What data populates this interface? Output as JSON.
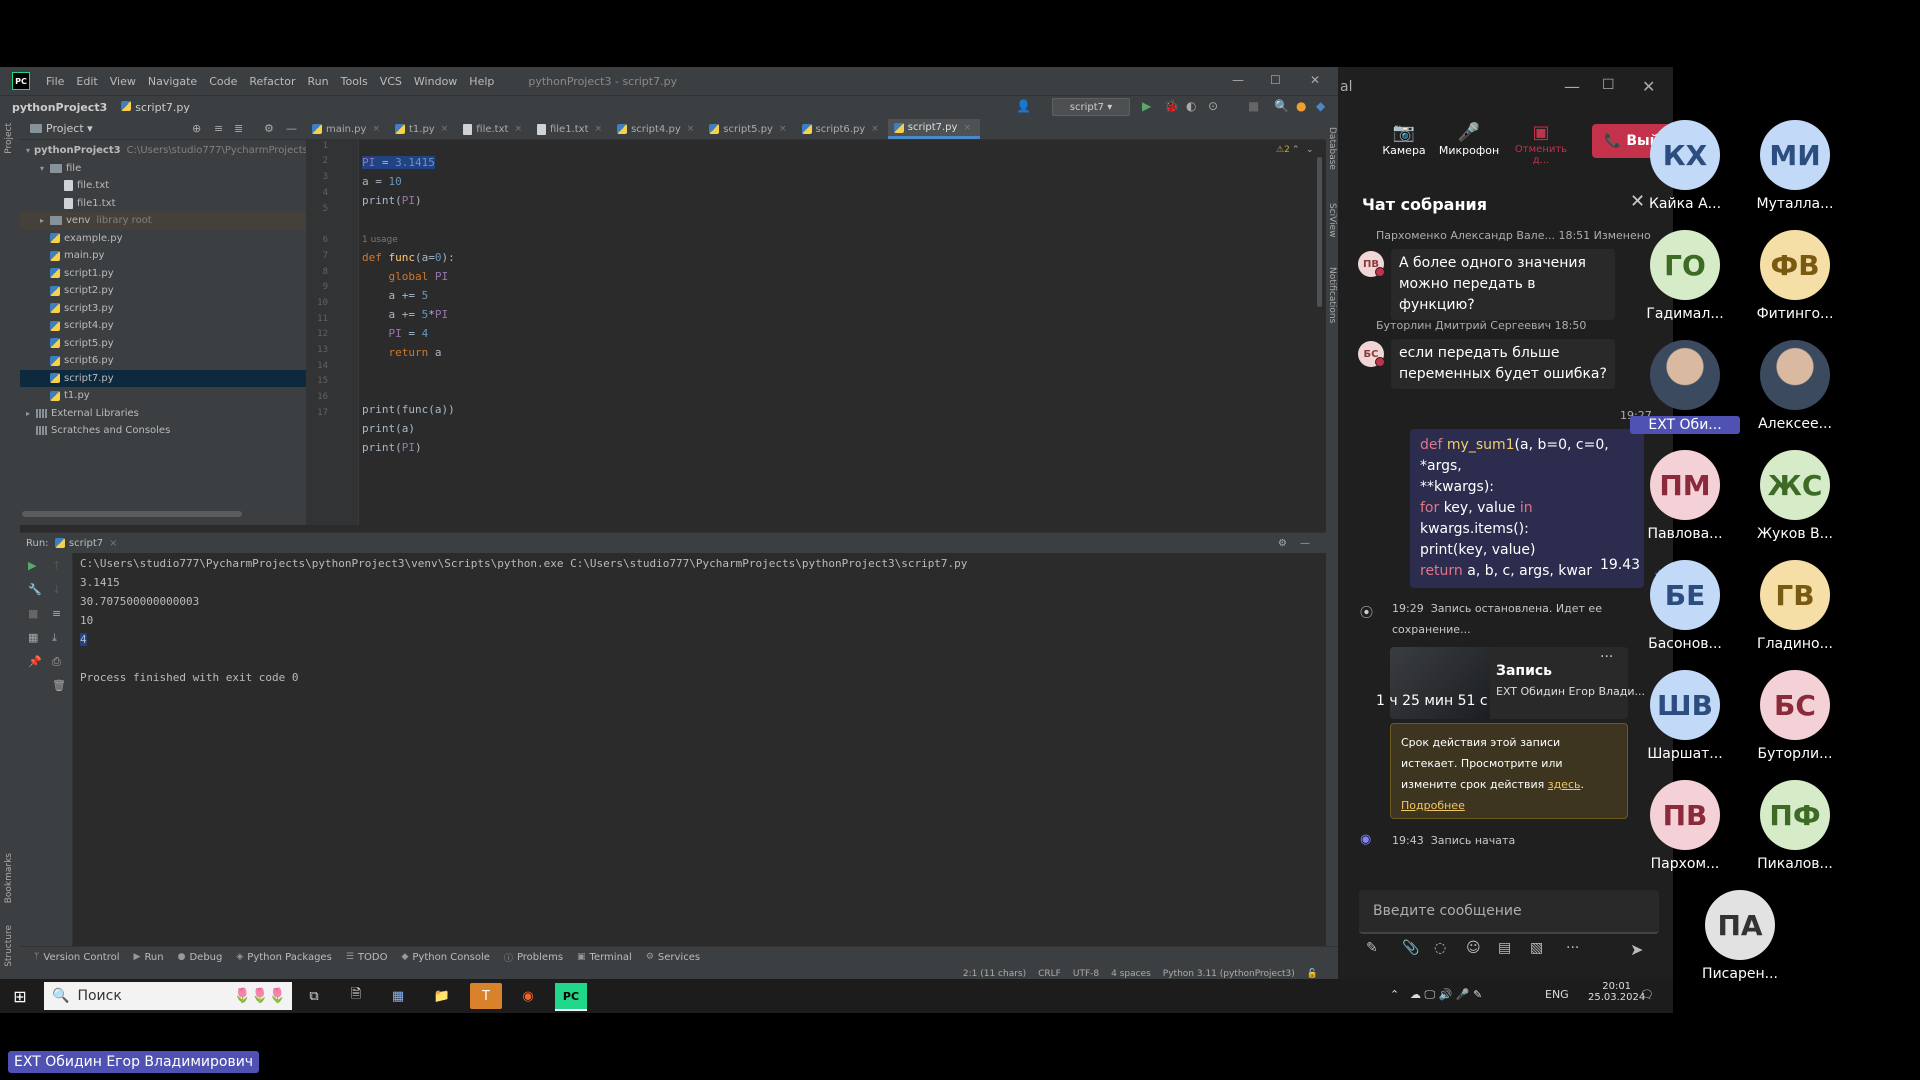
{
  "ide": {
    "logo": "PC",
    "menu": [
      "File",
      "Edit",
      "View",
      "Navigate",
      "Code",
      "Refactor",
      "Run",
      "Tools",
      "VCS",
      "Window",
      "Help"
    ],
    "window_title": "pythonProject3 - script7.py",
    "breadcrumb": [
      "pythonProject3",
      "script7.py"
    ],
    "run_config": "script7",
    "project_label": "Project",
    "tree": [
      {
        "label": "pythonProject3",
        "extra": "C:\\Users\\studio777\\PycharmProjects\\pythonProject3",
        "kind": "folder",
        "indent": 0,
        "open": true
      },
      {
        "label": "file",
        "kind": "folder",
        "indent": 1,
        "open": true
      },
      {
        "label": "file.txt",
        "kind": "txt",
        "indent": 2
      },
      {
        "label": "file1.txt",
        "kind": "txt",
        "indent": 2
      },
      {
        "label": "venv",
        "extra": "library root",
        "kind": "folder",
        "indent": 1,
        "open": false,
        "venv": true
      },
      {
        "label": "example.py",
        "kind": "py",
        "indent": 1
      },
      {
        "label": "main.py",
        "kind": "py",
        "indent": 1
      },
      {
        "label": "script1.py",
        "kind": "py",
        "indent": 1
      },
      {
        "label": "script2.py",
        "kind": "py",
        "indent": 1
      },
      {
        "label": "script3.py",
        "kind": "py",
        "indent": 1
      },
      {
        "label": "script4.py",
        "kind": "py",
        "indent": 1
      },
      {
        "label": "script5.py",
        "kind": "py",
        "indent": 1
      },
      {
        "label": "script6.py",
        "kind": "py",
        "indent": 1
      },
      {
        "label": "script7.py",
        "kind": "py",
        "indent": 1,
        "selected": true
      },
      {
        "label": "t1.py",
        "kind": "py",
        "indent": 1
      },
      {
        "label": "External Libraries",
        "kind": "lib",
        "indent": 0,
        "open": false
      },
      {
        "label": "Scratches and Consoles",
        "kind": "lib",
        "indent": 0
      }
    ],
    "tabs": [
      {
        "label": "main.py",
        "active": false
      },
      {
        "label": "t1.py",
        "active": false
      },
      {
        "label": "file.txt",
        "active": false
      },
      {
        "label": "file1.txt",
        "active": false
      },
      {
        "label": "script4.py",
        "active": false
      },
      {
        "label": "script5.py",
        "active": false
      },
      {
        "label": "script6.py",
        "active": false
      },
      {
        "label": "script7.py",
        "active": true
      }
    ],
    "warnings": "⚠2",
    "line_numbers": [
      "1",
      "2",
      "3",
      "4",
      "5",
      "",
      "6",
      "7",
      "8",
      "9",
      "10",
      "11",
      "12",
      "13",
      "14",
      "15",
      "16",
      "17"
    ],
    "usage_hint": "1 usage",
    "run_tab": "Run:",
    "run_name": "script7",
    "output": [
      "C:\\Users\\studio777\\PycharmProjects\\pythonProject3\\venv\\Scripts\\python.exe C:\\Users\\studio777\\PycharmProjects\\pythonProject3\\script7.py",
      "3.1415",
      "30.707500000000003",
      "10",
      "4",
      "",
      "Process finished with exit code 0"
    ],
    "toolwindows": [
      "Version Control",
      "Run",
      "Debug",
      "Python Packages",
      "TODO",
      "Python Console",
      "Problems",
      "Terminal",
      "Services"
    ],
    "status": [
      "2:1 (11 chars)",
      "CRLF",
      "UTF-8",
      "4 spaces",
      "Python 3.11 (pythonProject3)"
    ],
    "left_strip": [
      "Project",
      "Bookmarks",
      "Structure"
    ],
    "right_strip": [
      "Database",
      "SciView",
      "Notifications"
    ]
  },
  "taskbar": {
    "search_placeholder": "Поиск",
    "lang": "ENG",
    "time": "20:01",
    "date": "25.03.2024"
  },
  "teams": {
    "app_title_fragment": "al",
    "controls": {
      "camera": "Камера",
      "mic": "Микрофон",
      "share": "Отменить д...",
      "leave": "Выйти"
    },
    "chat_title": "Чат собрания",
    "messages": [
      {
        "meta": "Пархоменко Александр Вале...  18:51  Изменено",
        "initials": "ПВ",
        "text": [
          "А более одного значения",
          "можно передать в функцию?"
        ]
      },
      {
        "meta": "Буторлин Дмитрий Сергеевич  18:50",
        "initials": "БС",
        "text": [
          "если передать бльше",
          "переменных будет ошибка?"
        ]
      }
    ],
    "own_time": "19:27",
    "own_small": "19.43",
    "system": [
      {
        "time": "19:29",
        "text": "Запись остановлена. Идет ее",
        "text2": "сохранение..."
      },
      {
        "time": "19:43",
        "text": "Запись начата"
      }
    ],
    "recording": {
      "title": "Запись",
      "owner": "EXT Обидин Егор Влади...",
      "duration": "1 ч 25 мин 51 с"
    },
    "warning": {
      "line1": "Срок действия этой записи",
      "line2": "истекает. Просмотрите или",
      "line3": "измените срок действия",
      "link": "здесь",
      "more": "Подробнее"
    },
    "compose_placeholder": "Введите сообщение"
  },
  "participants": [
    {
      "initials": "КХ",
      "name": "Кайка А...",
      "bg": "#c2d9f7",
      "fg": "#2b4d80"
    },
    {
      "initials": "МИ",
      "name": "Муталла...",
      "bg": "#c2d9f7",
      "fg": "#2b4d80"
    },
    {
      "initials": "ГО",
      "name": "Гадимал...",
      "bg": "#d6ebc8",
      "fg": "#3d6b26"
    },
    {
      "initials": "ФВ",
      "name": "Фитинго...",
      "bg": "#f5dfa6",
      "fg": "#7a5a11"
    },
    {
      "initials": "",
      "name": "EXT Оби...",
      "photo": true,
      "active": true
    },
    {
      "initials": "",
      "name": "Алексее...",
      "photo": true
    },
    {
      "initials": "ПМ",
      "name": "Павлова...",
      "bg": "#f4d1d6",
      "fg": "#8a2a3a"
    },
    {
      "initials": "ЖС",
      "name": "Жуков В...",
      "bg": "#d6ebc8",
      "fg": "#3d6b26"
    },
    {
      "initials": "БЕ",
      "name": "Басонов...",
      "bg": "#c2d9f7",
      "fg": "#2b4d80"
    },
    {
      "initials": "ГВ",
      "name": "Гладино...",
      "bg": "#f5dfa6",
      "fg": "#7a5a11"
    },
    {
      "initials": "ШВ",
      "name": "Шаршат...",
      "bg": "#c2d9f7",
      "fg": "#2b4d80"
    },
    {
      "initials": "БС",
      "name": "Буторли...",
      "bg": "#f4d1d6",
      "fg": "#8a2a3a"
    },
    {
      "initials": "ПВ",
      "name": "Пархом...",
      "bg": "#f4d1d6",
      "fg": "#8a2a3a"
    },
    {
      "initials": "ПФ",
      "name": "Пикалов...",
      "bg": "#d6ebc8",
      "fg": "#3d6b26"
    },
    {
      "initials": "ПА",
      "name": "Писарен...",
      "bg": "#e2e2e2",
      "fg": "#333333"
    }
  ],
  "presenter": "EXT Обидин Егор Владимирович",
  "colors": {
    "accent": "#4f52b2",
    "leave": "#c4314b",
    "selection": "#214283"
  }
}
